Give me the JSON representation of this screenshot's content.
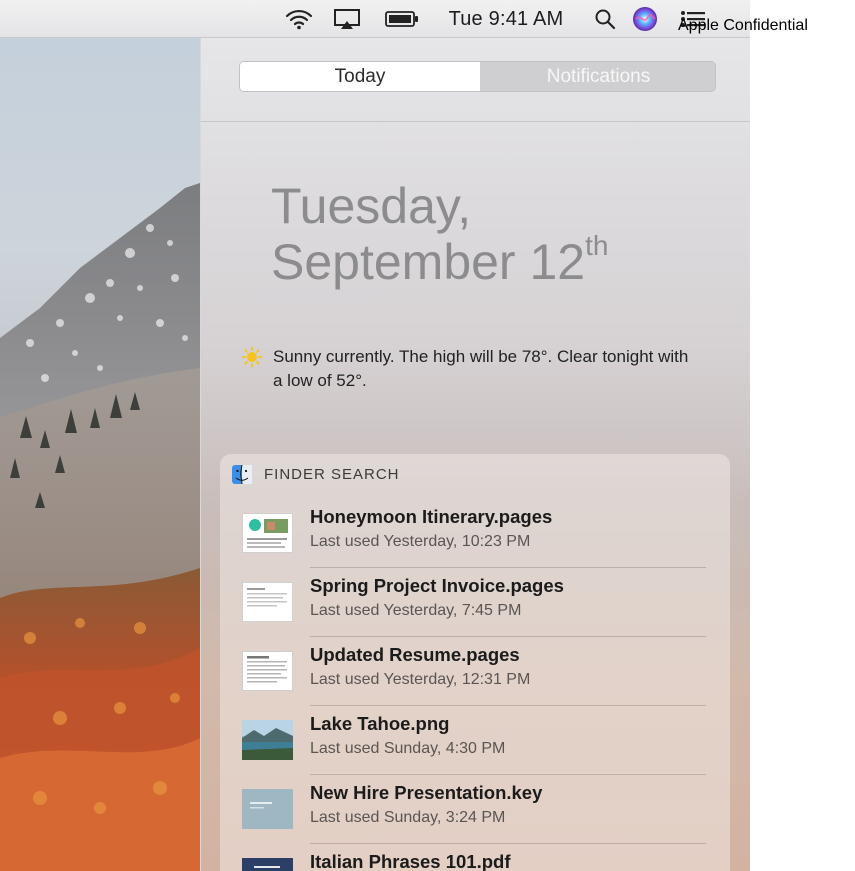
{
  "menubar": {
    "clock": "Tue 9:41 AM",
    "icons": [
      "wifi-icon",
      "airplay-icon",
      "battery-icon",
      "spotlight-search-icon",
      "siri-icon",
      "notification-center-icon"
    ]
  },
  "watermark": "Apple Confidential",
  "notification_center": {
    "tabs": [
      {
        "label": "Today",
        "selected": true
      },
      {
        "label": "Notifications",
        "selected": false
      }
    ],
    "date": {
      "line1": "Tuesday,",
      "line2": "September 12",
      "suffix": "th"
    },
    "weather": {
      "icon": "sun-icon",
      "text": "Sunny currently. The high will be 78°.  Clear tonight with a low of 52°."
    },
    "finder_search": {
      "title": "FINDER SEARCH",
      "results": [
        {
          "name": "Honeymoon Itinerary.pages",
          "meta": "Last used Yesterday, 10:23 PM",
          "icon": "pages-document-thumbnail"
        },
        {
          "name": "Spring Project Invoice.pages",
          "meta": "Last used Yesterday, 7:45 PM",
          "icon": "pages-document-thumbnail"
        },
        {
          "name": "Updated Resume.pages",
          "meta": "Last used Yesterday, 12:31 PM",
          "icon": "pages-document-thumbnail"
        },
        {
          "name": "Lake Tahoe.png",
          "meta": "Last used Sunday, 4:30 PM",
          "icon": "image-thumbnail"
        },
        {
          "name": "New Hire Presentation.key",
          "meta": "Last used Sunday, 3:24 PM",
          "icon": "keynote-thumbnail"
        },
        {
          "name": "Italian Phrases 101.pdf",
          "meta": "",
          "icon": "pdf-thumbnail"
        }
      ]
    }
  },
  "colors": {
    "date_text": "#8c8c8e",
    "segment_selected_bg": "#ffffff",
    "segment_unselected_bg": "#cfcfd2",
    "sun": "#f7c21b"
  }
}
